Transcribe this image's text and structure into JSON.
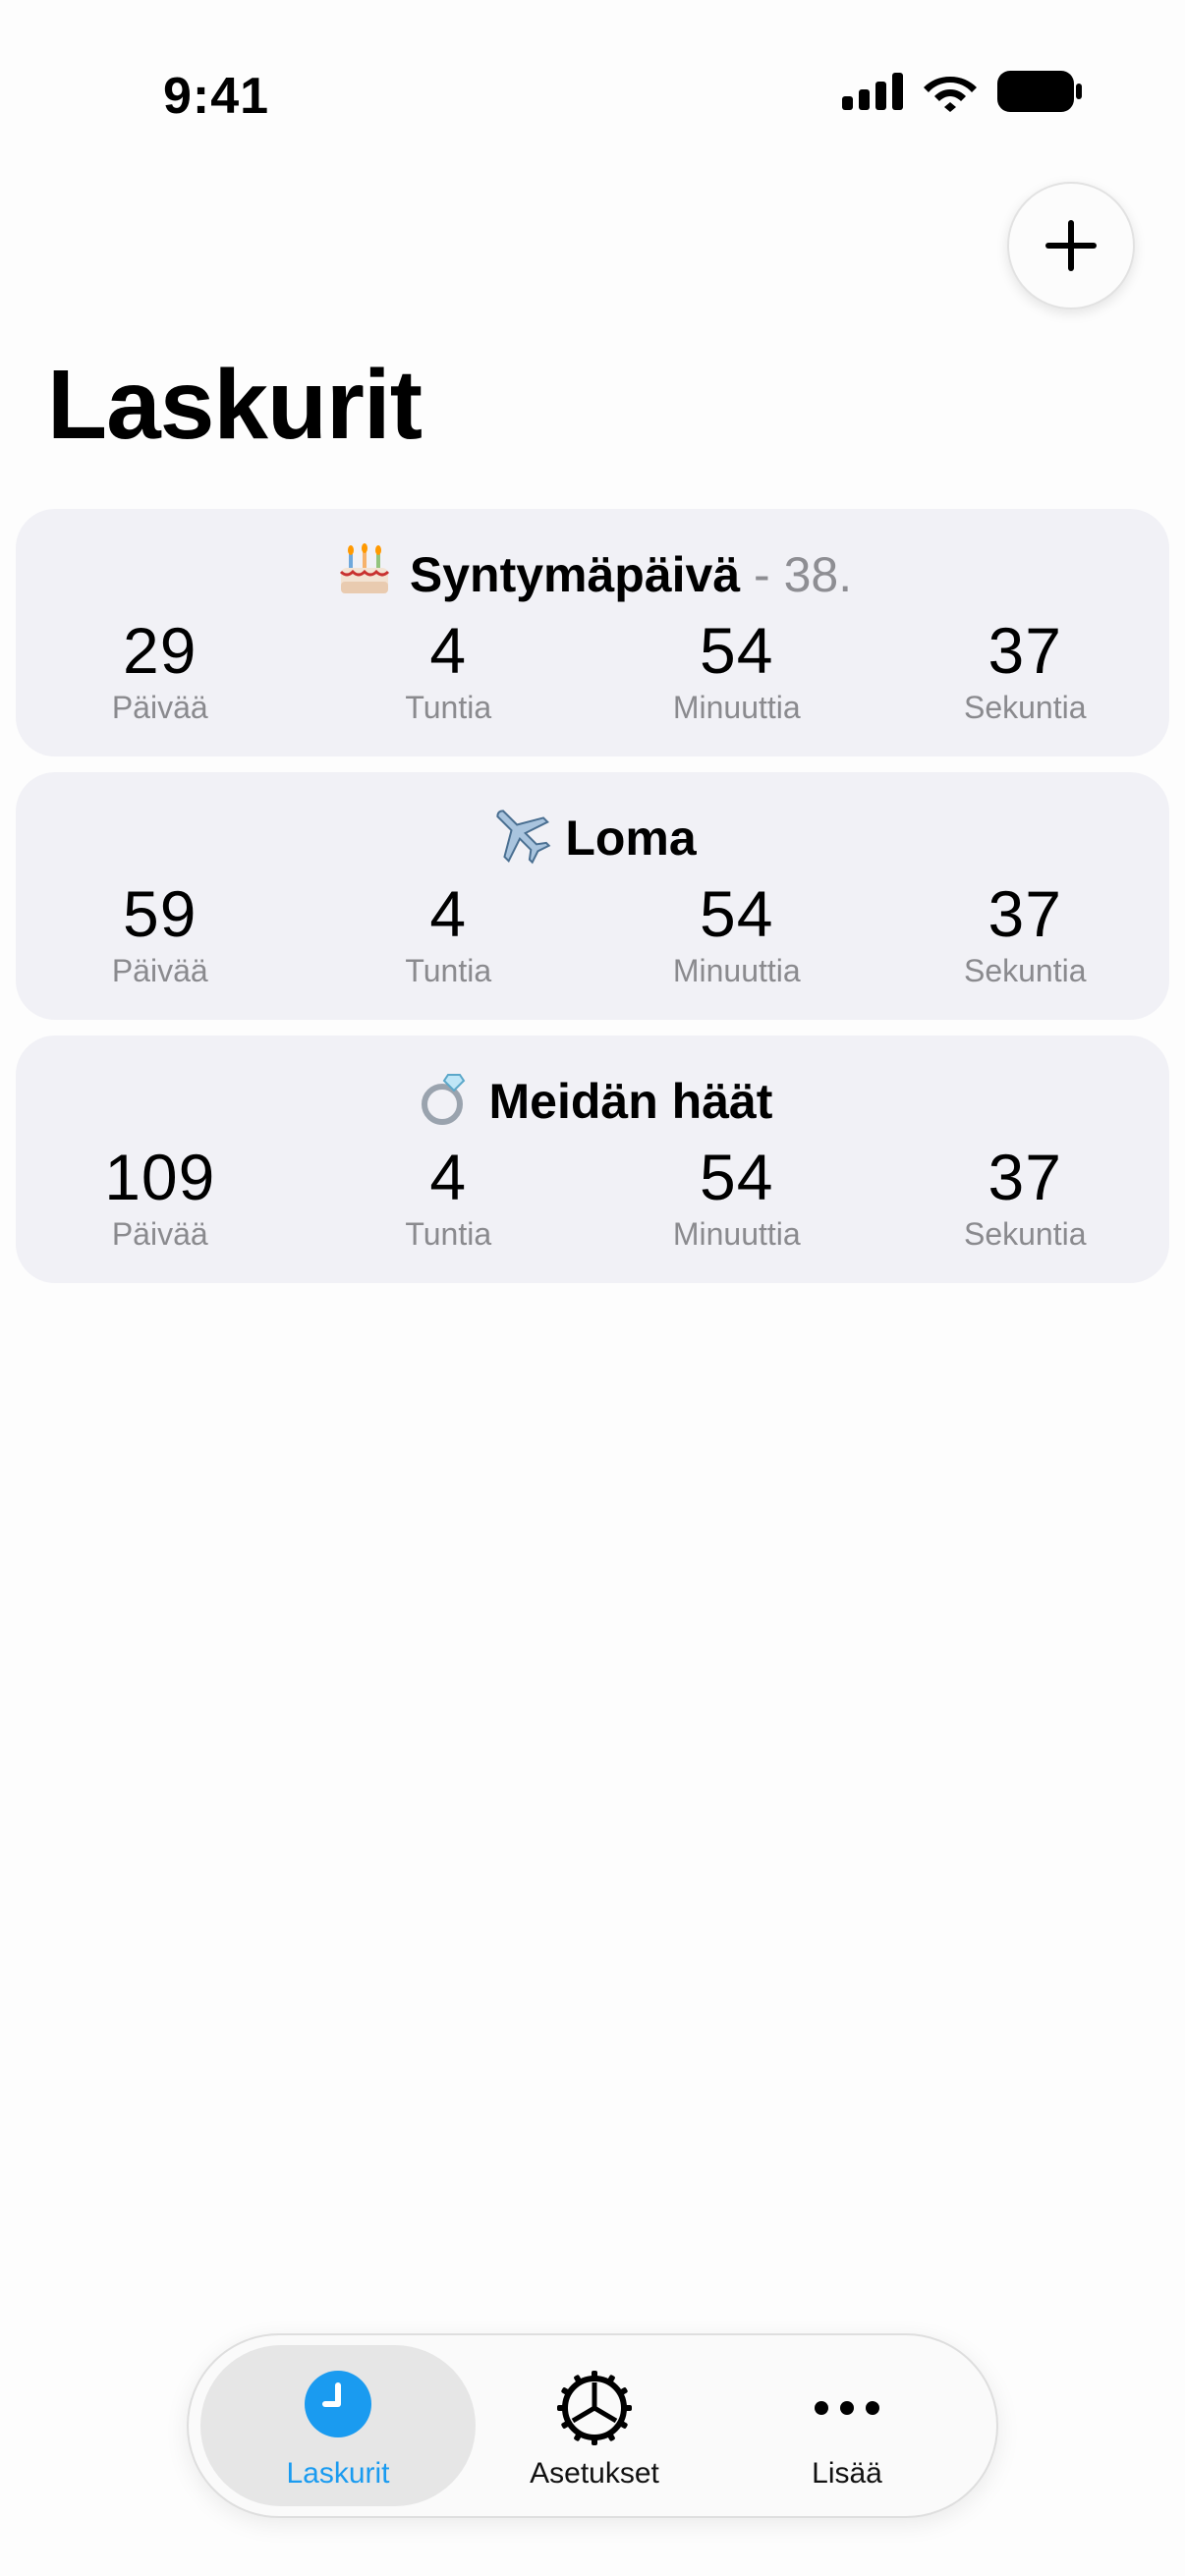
{
  "status_bar": {
    "time": "9:41"
  },
  "header": {
    "title": "Laskurit",
    "add_button_icon": "plus-icon"
  },
  "counters": [
    {
      "emoji": "birthday-cake-icon",
      "title": "Syntymäpäivä",
      "suffix": " - 38.",
      "units": [
        {
          "value": "29",
          "label": "Päivää"
        },
        {
          "value": "4",
          "label": "Tuntia"
        },
        {
          "value": "54",
          "label": "Minuuttia"
        },
        {
          "value": "37",
          "label": "Sekuntia"
        }
      ]
    },
    {
      "emoji": "airplane-icon",
      "title": "Loma",
      "suffix": "",
      "units": [
        {
          "value": "59",
          "label": "Päivää"
        },
        {
          "value": "4",
          "label": "Tuntia"
        },
        {
          "value": "54",
          "label": "Minuuttia"
        },
        {
          "value": "37",
          "label": "Sekuntia"
        }
      ]
    },
    {
      "emoji": "ring-icon",
      "title": "Meidän häät",
      "suffix": "",
      "units": [
        {
          "value": "109",
          "label": "Päivää"
        },
        {
          "value": "4",
          "label": "Tuntia"
        },
        {
          "value": "54",
          "label": "Minuuttia"
        },
        {
          "value": "37",
          "label": "Sekuntia"
        }
      ]
    }
  ],
  "tab_bar": {
    "items": [
      {
        "label": "Laskurit",
        "icon": "clock-icon",
        "active": true
      },
      {
        "label": "Asetukset",
        "icon": "gear-icon",
        "active": false
      },
      {
        "label": "Lisää",
        "icon": "more-icon",
        "active": false
      }
    ]
  },
  "colors": {
    "accent": "#1A9BF0",
    "card_background": "#F1F1F6",
    "secondary_text": "#8E8E93"
  }
}
